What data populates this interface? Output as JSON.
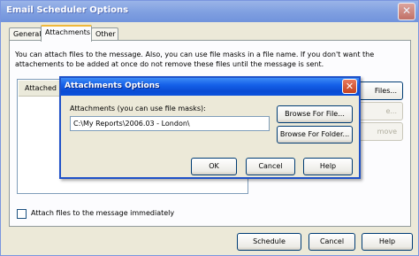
{
  "window": {
    "title": "Email Scheduler Options"
  },
  "tabs": [
    {
      "label": "General"
    },
    {
      "label": "Attachments"
    },
    {
      "label": "Other"
    }
  ],
  "attachments_tab": {
    "description": "You can attach files to the message. Also, you can use file masks in a file name. If you don't want the attachements to be added at once do not remove these files until the message is sent.",
    "list_header": "Attached F",
    "side_buttons": [
      "Files...",
      "e...",
      "move"
    ],
    "checkbox_label": "Attach files to the message immediately",
    "checkbox_checked": false
  },
  "footer": {
    "schedule_label": "Schedule",
    "cancel_label": "Cancel",
    "help_label": "Help"
  },
  "dialog": {
    "title": "Attachments Options",
    "field_label": "Attachments (you can use file masks):",
    "field_value": "C:\\My Reports\\2006.03 - London\\",
    "browse_file_label": "Browse For File...",
    "browse_folder_label": "Browse For Folder...",
    "ok_label": "OK",
    "cancel_label": "Cancel",
    "help_label": "Help"
  },
  "colors": {
    "dialog_titlebar": "#0a4bd3",
    "close_button": "#c5421e",
    "window_bg": "#ece9d8"
  },
  "icons": {
    "window_close": "close-icon",
    "dialog_close": "close-icon"
  }
}
